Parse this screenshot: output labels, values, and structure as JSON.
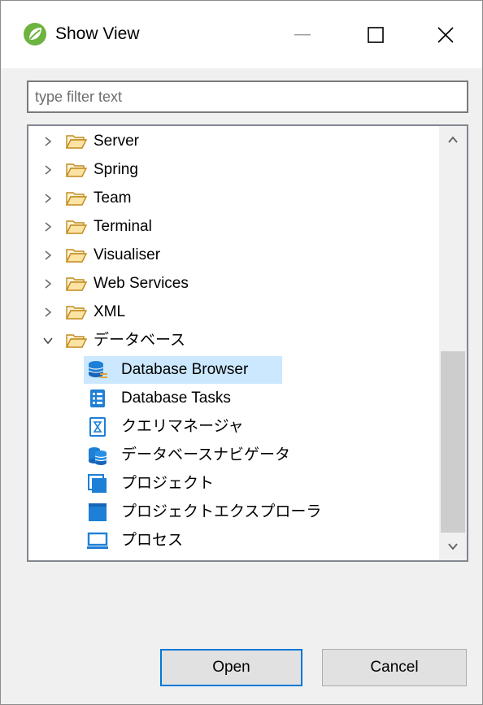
{
  "window": {
    "title": "Show View",
    "minimize_glyph": "—",
    "maximize_glyph": "☐",
    "close_glyph": "✕"
  },
  "filter": {
    "placeholder": "type filter text",
    "value": ""
  },
  "tree": {
    "categories": [
      {
        "label": "Server",
        "expanded": false,
        "icon": "folder-icon"
      },
      {
        "label": "Spring",
        "expanded": false,
        "icon": "folder-icon"
      },
      {
        "label": "Team",
        "expanded": false,
        "icon": "folder-icon"
      },
      {
        "label": "Terminal",
        "expanded": false,
        "icon": "folder-icon"
      },
      {
        "label": "Visualiser",
        "expanded": false,
        "icon": "folder-icon"
      },
      {
        "label": "Web Services",
        "expanded": false,
        "icon": "folder-icon"
      },
      {
        "label": "XML",
        "expanded": false,
        "icon": "folder-icon"
      },
      {
        "label": "データベース",
        "expanded": true,
        "icon": "folder-icon"
      }
    ],
    "children": [
      {
        "label": "Database Browser",
        "icon": "database-browser-icon",
        "selected": true
      },
      {
        "label": "Database Tasks",
        "icon": "database-tasks-icon",
        "selected": false
      },
      {
        "label": "クエリマネージャ",
        "icon": "query-manager-icon",
        "selected": false
      },
      {
        "label": "データベースナビゲータ",
        "icon": "database-navigator-icon",
        "selected": false
      },
      {
        "label": "プロジェクト",
        "icon": "project-icon",
        "selected": false
      },
      {
        "label": "プロジェクトエクスプローラ",
        "icon": "project-explorer-icon",
        "selected": false
      },
      {
        "label": "プロセス",
        "icon": "process-icon",
        "selected": false
      }
    ]
  },
  "buttons": {
    "open": "Open",
    "cancel": "Cancel"
  },
  "colors": {
    "selection": "#cce8ff",
    "folder": "#e8b755",
    "accent": "#0078d7",
    "icon_blue": "#1e7fd6"
  }
}
